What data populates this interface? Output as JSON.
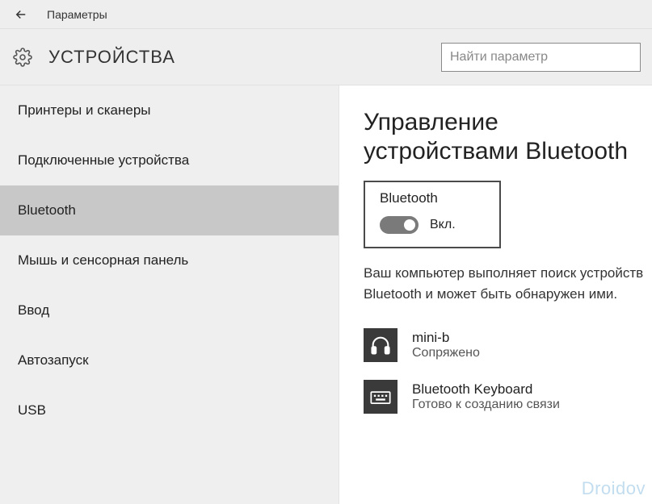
{
  "titlebar": {
    "label": "Параметры"
  },
  "header": {
    "title": "УСТРОЙСТВА",
    "search_placeholder": "Найти параметр"
  },
  "sidebar": {
    "items": [
      {
        "label": "Принтеры и сканеры"
      },
      {
        "label": "Подключенные устройства"
      },
      {
        "label": "Bluetooth"
      },
      {
        "label": "Мышь и сенсорная панель"
      },
      {
        "label": "Ввод"
      },
      {
        "label": "Автозапуск"
      },
      {
        "label": "USB"
      }
    ],
    "selected_index": 2
  },
  "content": {
    "title": "Управление устройствами Bluetooth",
    "toggle": {
      "label": "Bluetooth",
      "state_text": "Вкл.",
      "on": true
    },
    "status_text": "Ваш компьютер выполняет поиск устройств Bluetooth и может быть обнаружен ими.",
    "devices": [
      {
        "icon": "headset-icon",
        "name": "mini-b",
        "status": "Сопряжено"
      },
      {
        "icon": "keyboard-icon",
        "name": "Bluetooth Keyboard",
        "status": "Готово к созданию связи"
      }
    ]
  },
  "watermark": "Droidov"
}
